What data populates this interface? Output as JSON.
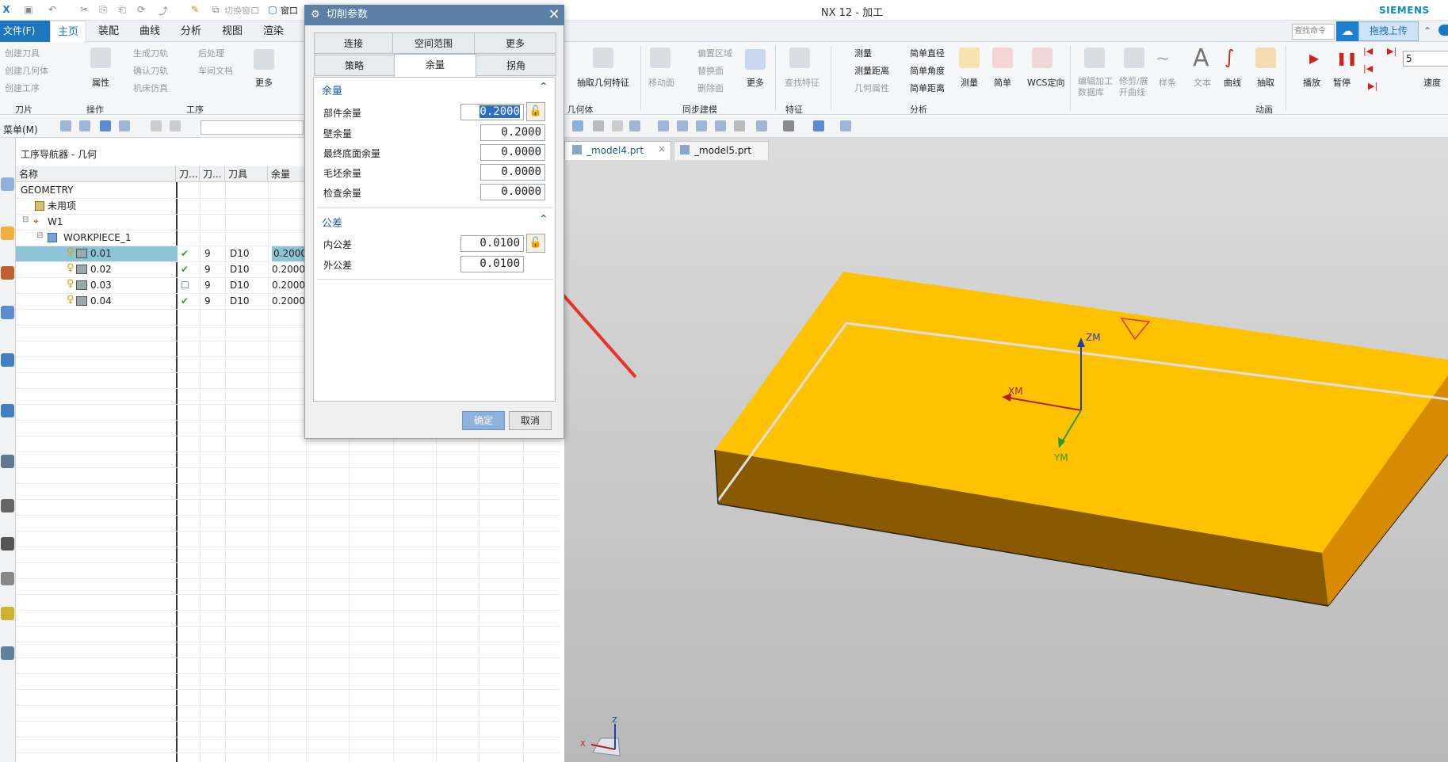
{
  "app": {
    "title": "NX 12 - 加工",
    "brand": "SIEMENS"
  },
  "menu": {
    "file": "文件(F)",
    "tabs": [
      "主页",
      "装配",
      "曲线",
      "分析",
      "视图",
      "渲染"
    ],
    "window_label": "窗口",
    "switch_window": "切换窗口",
    "search_placeholder": "查找命令",
    "upload": "拖拽上传"
  },
  "ribbon": {
    "tool_items": [
      "创建刀具",
      "创建几何体",
      "创建工序"
    ],
    "properties": "属性",
    "ops_items": [
      "生成刀轨",
      "确认刀轨",
      "机床仿真"
    ],
    "post_items": [
      "后处理",
      "车间文档"
    ],
    "more": "更多",
    "extract_geometry": "抽取几何特征",
    "move_face": "移动面",
    "sync_items": [
      "偏置区域",
      "替换面",
      "删除面"
    ],
    "more2": "更多",
    "find_feature": "查找特征",
    "measure_items": [
      "测量",
      "测量距离",
      "几何属性"
    ],
    "simple_items": [
      "简单直径",
      "简单角度",
      "简单距离"
    ],
    "measure": "测量",
    "simple": "简单",
    "wcs": "WCS定向",
    "edit_db": "编辑加工数据库",
    "trim_curve": "修剪/展开曲线",
    "spline": "样条",
    "text": "文本",
    "curve": "曲线",
    "extract": "抽取",
    "play": "播放",
    "pause": "暂停",
    "speed": "速度",
    "speed_value": "5",
    "groups": {
      "tool": "刀片",
      "ops": "操作",
      "process": "工序",
      "geometry": "几何体",
      "sync": "同步建模",
      "feature": "特征",
      "analysis": "分析",
      "animation": "动画"
    }
  },
  "toolbar2": {
    "menu": "菜单(M)"
  },
  "navigator": {
    "title": "工序导航器 - 几何",
    "columns": [
      "名称",
      "刀...",
      "刀...",
      "刀具",
      "余量"
    ],
    "rows": [
      {
        "name": "GEOMETRY",
        "c1": "",
        "c2": "",
        "tool": "",
        "stock": ""
      },
      {
        "name": "未用项",
        "c1": "",
        "c2": "",
        "tool": "",
        "stock": ""
      },
      {
        "name": "W1",
        "c1": "",
        "c2": "",
        "tool": "",
        "stock": ""
      },
      {
        "name": "WORKPIECE_1",
        "c1": "",
        "c2": "",
        "tool": "",
        "stock": ""
      },
      {
        "name": "0.01",
        "c1": "✔",
        "c2": "9",
        "tool": "D10",
        "stock": "0.2000"
      },
      {
        "name": "0.02",
        "c1": "✔",
        "c2": "9",
        "tool": "D10",
        "stock": "0.2000"
      },
      {
        "name": "0.03",
        "c1": "☐",
        "c2": "9",
        "tool": "D10",
        "stock": "0.2000"
      },
      {
        "name": "0.04",
        "c1": "✔",
        "c2": "9",
        "tool": "D10",
        "stock": "0.2000"
      }
    ]
  },
  "dialog": {
    "title": "切削参数",
    "tabs_row1": [
      "连接",
      "空间范围",
      "更多"
    ],
    "tabs_row2": [
      "策略",
      "余量",
      "拐角"
    ],
    "stock_section": "余量",
    "stock_fields": [
      {
        "label": "部件余量",
        "value": "0.2000"
      },
      {
        "label": "壁余量",
        "value": "0.2000"
      },
      {
        "label": "最终底面余量",
        "value": "0.0000"
      },
      {
        "label": "毛坯余量",
        "value": "0.0000"
      },
      {
        "label": "检查余量",
        "value": "0.0000"
      }
    ],
    "tol_section": "公差",
    "tol_fields": [
      {
        "label": "内公差",
        "value": "0.0100"
      },
      {
        "label": "外公差",
        "value": "0.0100"
      }
    ],
    "ok": "确定",
    "cancel": "取消"
  },
  "viewport": {
    "tabs": [
      "_model4.prt",
      "_model5.prt"
    ],
    "axes": {
      "zm": "ZM",
      "xm": "XM",
      "ym": "YM",
      "z": "Z",
      "x": "X"
    }
  },
  "colors": {
    "accent": "#1f76c0",
    "part_top": "#ffc200",
    "part_front": "#8a5a00",
    "part_side": "#d88a00",
    "arrow": "#e8322a"
  }
}
